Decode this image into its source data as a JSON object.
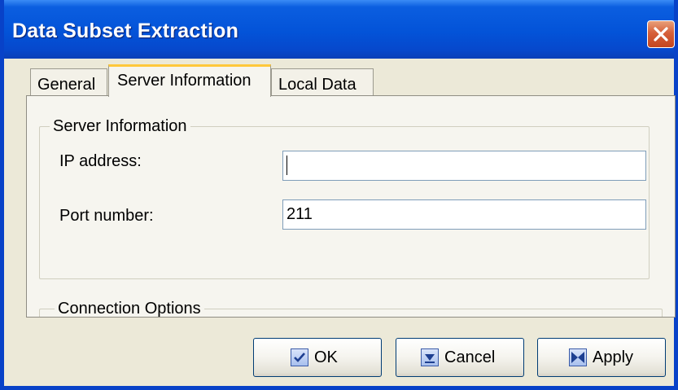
{
  "window": {
    "title": "Data Subset Extraction"
  },
  "tabs": [
    {
      "label": "General",
      "active": false
    },
    {
      "label": "Server Information",
      "active": true
    },
    {
      "label": "Local Data",
      "active": false
    }
  ],
  "server_group": {
    "legend": "Server Information",
    "ip_label": "IP address:",
    "ip_value": "",
    "port_label": "Port number:",
    "port_value": "211"
  },
  "connection_group": {
    "legend": "Connection Options"
  },
  "buttons": {
    "ok": {
      "label": "OK",
      "icon": "check-icon"
    },
    "cancel": {
      "label": "Cancel",
      "icon": "cancel-icon"
    },
    "apply": {
      "label": "Apply",
      "icon": "apply-icon"
    }
  },
  "colors": {
    "titlebar": "#0353D8",
    "close": "#D6603A",
    "face": "#ECE9D8",
    "tab_hot": "#FFC83C"
  }
}
